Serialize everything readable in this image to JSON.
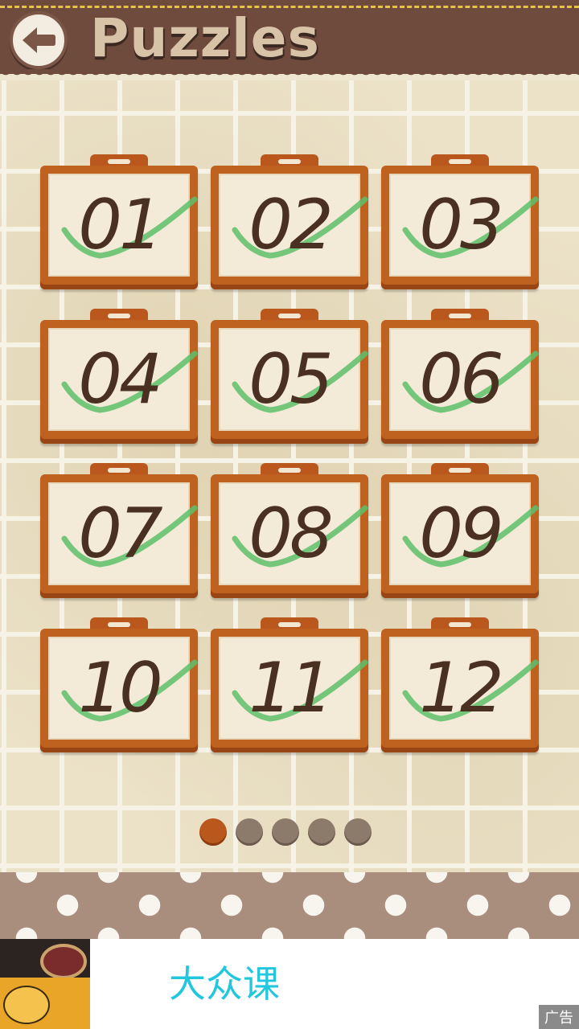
{
  "header": {
    "title": "Puzzles",
    "back_icon": "back-arrow-icon",
    "colors": {
      "bar": "#6e4b3c",
      "stitch": "#e8c34a",
      "title": "#d8c3a8"
    }
  },
  "levels": [
    {
      "label": "01",
      "completed": true
    },
    {
      "label": "02",
      "completed": true
    },
    {
      "label": "03",
      "completed": true
    },
    {
      "label": "04",
      "completed": true
    },
    {
      "label": "05",
      "completed": true
    },
    {
      "label": "06",
      "completed": true
    },
    {
      "label": "07",
      "completed": true
    },
    {
      "label": "08",
      "completed": true
    },
    {
      "label": "09",
      "completed": true
    },
    {
      "label": "10",
      "completed": true
    },
    {
      "label": "11",
      "completed": true
    },
    {
      "label": "12",
      "completed": true
    }
  ],
  "pager": {
    "pages": 5,
    "current": 1,
    "active_color": "#b9571d",
    "inactive_color": "#8c7a6b"
  },
  "ad": {
    "text": "大众课",
    "tag": "广告"
  }
}
